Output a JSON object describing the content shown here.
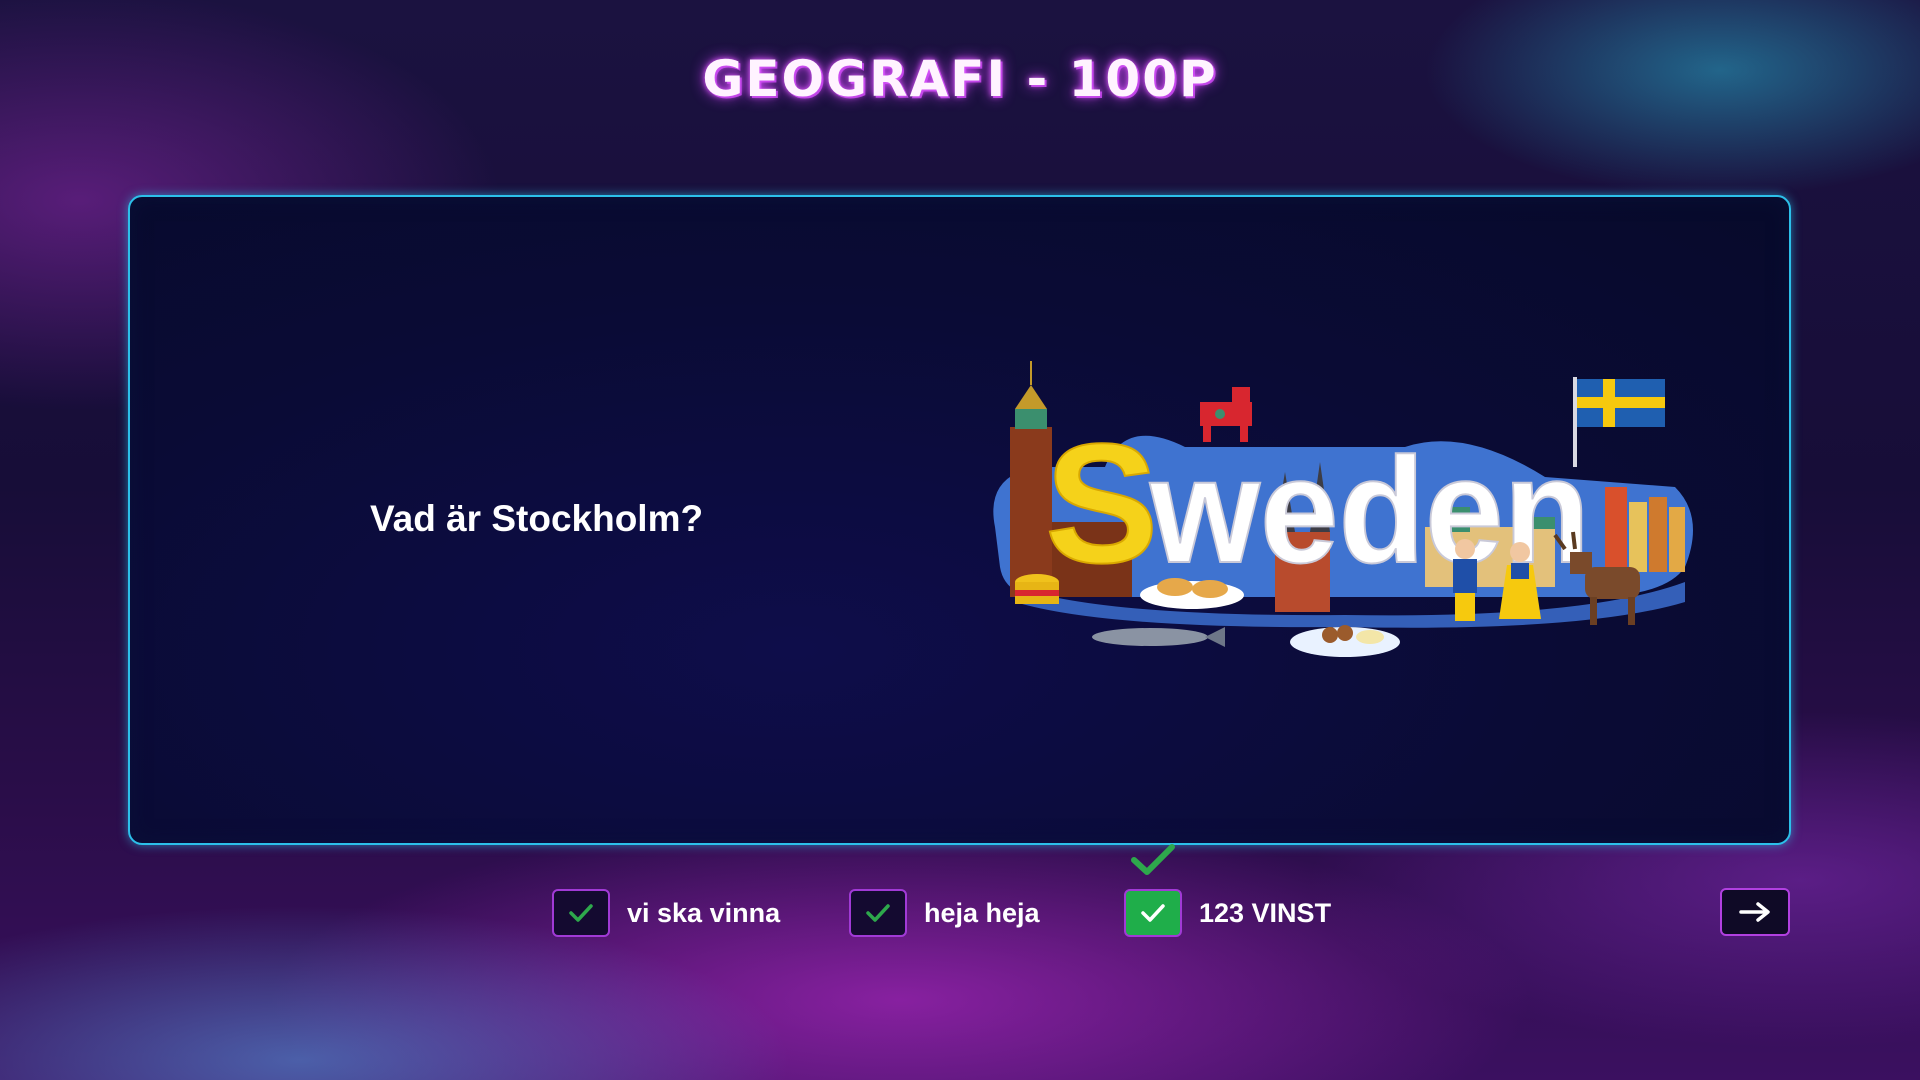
{
  "header": {
    "title": "GEOGRAFI - 100P"
  },
  "question_card": {
    "answer_text": "Vad är Stockholm?",
    "image": {
      "word": "Sweden",
      "description_icons": [
        "city-hall-tower-icon",
        "dala-horse-icon",
        "swedish-flag-icon",
        "church-icon",
        "castle-icon",
        "couple-in-folk-costume-icon",
        "moose-icon",
        "colorful-houses-icon",
        "surstromming-can-icon",
        "herring-fish-icon",
        "meatballs-plate-icon",
        "cinnamon-buns-plate-icon"
      ],
      "colors": {
        "letter_s": "#f5d21a",
        "letters": "#ffffff",
        "flag_blue": "#1f5fb0",
        "flag_yellow": "#f6c90e",
        "backdrop_blue": "#3f73d0"
      }
    }
  },
  "options": [
    {
      "label": "vi ska vinna",
      "selected": false
    },
    {
      "label": "heja heja",
      "selected": false
    },
    {
      "label": "123 VINST",
      "selected": true,
      "correct": true
    }
  ],
  "navigation": {
    "next_icon": "arrow-right-icon"
  },
  "theme": {
    "accent_cyan": "#2cc0ea",
    "accent_purple": "#a13ad6",
    "check_green": "#1fae4a",
    "correct_mark_green": "#2ea84c"
  }
}
